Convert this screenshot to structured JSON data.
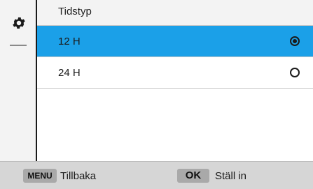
{
  "sidebar": {
    "icon": "gear-icon"
  },
  "header": {
    "title": "Tidstyp"
  },
  "options": [
    {
      "label": "12 H",
      "selected": true
    },
    {
      "label": "24 H",
      "selected": false
    }
  ],
  "footer": {
    "menu_key": "MENU",
    "back_label": "Tillbaka",
    "ok_key": "OK",
    "set_label": "Ställ in"
  },
  "colors": {
    "accent": "#1ba0e8"
  }
}
